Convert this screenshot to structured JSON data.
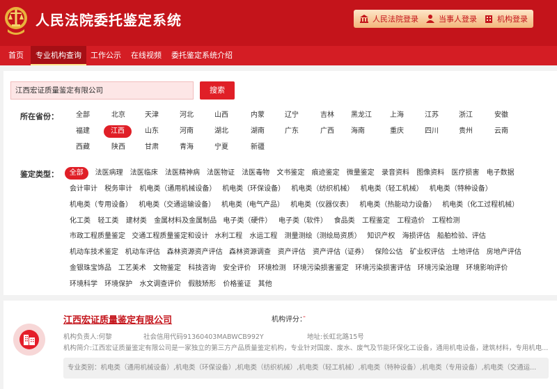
{
  "header": {
    "title": "人民法院委托鉴定系统",
    "buttons": [
      {
        "label": "人民法院登录",
        "icon": "court-building-icon"
      },
      {
        "label": "当事人登录",
        "icon": "person-icon"
      },
      {
        "label": "机构登录",
        "icon": "institution-icon"
      }
    ],
    "colors": {
      "primary": "#c4141b",
      "nav": "#d41d24",
      "accent": "#e01f27"
    }
  },
  "nav": {
    "items": [
      "首页",
      "专业机构查询",
      "工作公示",
      "在线视频",
      "委托鉴定系统介绍"
    ],
    "active": "专业机构查询"
  },
  "search": {
    "value": "江西宏证质量鉴定有限公司",
    "button_label": "搜索"
  },
  "province": {
    "label": "所在省份：",
    "selected": "江西",
    "rows": [
      [
        "全部",
        "北京",
        "天津",
        "河北",
        "山西",
        "内蒙",
        "辽宁",
        "吉林",
        "黑龙江",
        "上海",
        "江苏",
        "浙江",
        "安徽"
      ],
      [
        "福建",
        "江西",
        "山东",
        "河南",
        "湖北",
        "湖南",
        "广东",
        "广西",
        "海南",
        "重庆",
        "四川",
        "贵州",
        "云南"
      ],
      [
        "西藏",
        "陕西",
        "甘肃",
        "青海",
        "宁夏",
        "新疆"
      ]
    ]
  },
  "category": {
    "label": "鉴定类型：",
    "selected": "全部",
    "rows": [
      [
        "全部",
        "法医病理",
        "法医临床",
        "法医精神病",
        "法医物证",
        "法医毒物",
        "文书鉴定",
        "痕迹鉴定",
        "微量鉴定",
        "录音资料",
        "图像资料",
        "医疗损害",
        "电子数据"
      ],
      [
        "会计审计",
        "税务审计",
        "机电类（通用机械设备）",
        "机电类（环保设备）",
        "机电类（纺织机械）",
        "机电类（轻工机械）",
        "机电类（特种设备）"
      ],
      [
        "机电类（专用设备）",
        "机电类（交通运输设备）",
        "机电类（电气产品）",
        "机电类（仪器仪表）",
        "机电类（热能动力设备）",
        "机电类（化工过程机械）"
      ],
      [
        "化工类",
        "轻工类",
        "建材类",
        "金属材料及金属制品",
        "电子类（硬件）",
        "电子类（软件）",
        "食品类",
        "工程鉴定",
        "工程造价",
        "工程检测"
      ],
      [
        "市政工程质量鉴定",
        "交通工程质量鉴定和设计",
        "水利工程",
        "水运工程",
        "测量测绘（测绘局资质）",
        "知识产权",
        "海损评估",
        "船舶检验、评估"
      ],
      [
        "机动车技术鉴定",
        "机动车评估",
        "森林资源资产评估",
        "森林资源调查",
        "资产评估",
        "资产评估（证券）",
        "保险公估",
        "矿业权评估",
        "土地评估",
        "房地产评估"
      ],
      [
        "金银珠宝饰品",
        "工艺美术",
        "文物鉴定",
        "科技咨询",
        "安全评价",
        "环境检测",
        "环境污染损害鉴定",
        "环境污染损害评估",
        "环境污染治理",
        "环境影响评价"
      ],
      [
        "环境科学",
        "环境保护",
        "水文调查评价",
        "假肢矫形",
        "价格鉴证",
        "其他"
      ]
    ]
  },
  "result": {
    "name": "江西宏证质量鉴定有限公司",
    "rating_label": "机构评分：",
    "rating_value": "-",
    "logo_icon": "building-icon",
    "responsible": "机构负责人:何黎",
    "credit_code": "社会信用代码91360403MABWCB992Y",
    "address": "地址:长虹北路15号",
    "intro": "机构简介:江西宏证质量鉴定有限公司是一家独立的第三方产品质量鉴定机构，专业针对国废、废水、废气及节能环保化工设备，通用机电设备，建筑材料，专用机电...",
    "business": "专业类别：机电类（通用机械设备）,机电类（环保设备）,机电类（纺织机械）,机电类（轻工机械）,机电类（特种设备）,机电类（专用设备）,机电类（交通运..."
  }
}
